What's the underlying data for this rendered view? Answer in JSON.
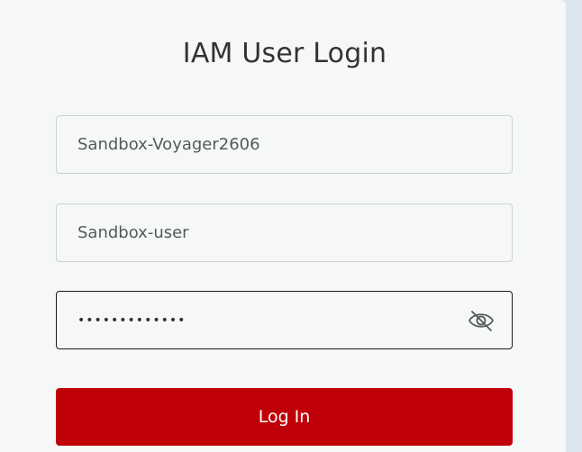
{
  "login": {
    "title": "IAM User Login",
    "account": {
      "value": "Sandbox-Voyager2606"
    },
    "username": {
      "value": "Sandbox-user"
    },
    "password": {
      "value": "•••••••••••••",
      "visibility_icon": "eye-slash-icon"
    },
    "submit_label": "Log In"
  },
  "colors": {
    "page_background": "#dde6ee",
    "card_background": "#f5f8f7",
    "button": "#bf0008",
    "button_text": "#ffffff",
    "title_text": "#333333"
  }
}
